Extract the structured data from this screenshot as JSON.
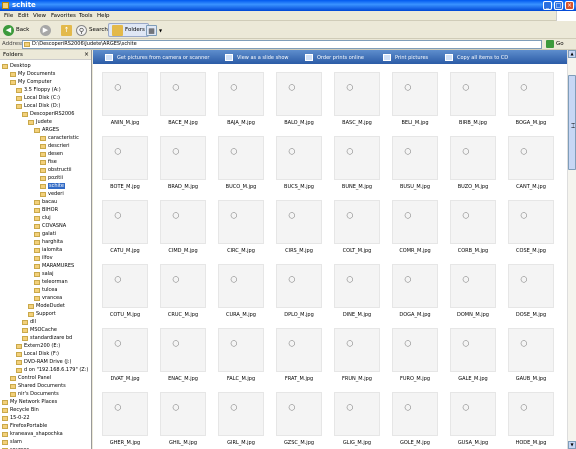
{
  "window": {
    "title": "schite",
    "minimize": "_",
    "maximize": "□",
    "close": "×"
  },
  "menu": [
    "File",
    "Edit",
    "View",
    "Favorites",
    "Tools",
    "Help"
  ],
  "toolbar": {
    "back": "Back",
    "search": "Search",
    "folders": "Folders"
  },
  "address": {
    "label": "Address",
    "path": "D:\\DescoperiRS2006\\Judete\\ARGES\\schite",
    "go": "Go"
  },
  "folders_pane": {
    "title": "Folders",
    "tree": [
      {
        "label": "Desktop",
        "sel": false
      },
      {
        "label": "My Documents",
        "sel": false
      },
      {
        "label": "My Computer",
        "sel": false
      },
      {
        "label": "3.5 Floppy (A:)",
        "sel": false
      },
      {
        "label": "Local Disk (C:)",
        "sel": false
      },
      {
        "label": "Local Disk (D:)",
        "sel": false
      },
      {
        "label": "DescoperiRS2006",
        "sel": false
      },
      {
        "label": "Judete",
        "sel": false
      },
      {
        "label": "ARGES",
        "sel": false
      },
      {
        "label": "caracteristic",
        "sel": false
      },
      {
        "label": "descrieri",
        "sel": false
      },
      {
        "label": "desen",
        "sel": false
      },
      {
        "label": "fise",
        "sel": false
      },
      {
        "label": "obstructii",
        "sel": false
      },
      {
        "label": "pozitii",
        "sel": false
      },
      {
        "label": "schite",
        "sel": true
      },
      {
        "label": "vederi",
        "sel": false
      },
      {
        "label": "bacau",
        "sel": false
      },
      {
        "label": "BIHOR",
        "sel": false
      },
      {
        "label": "cluj",
        "sel": false
      },
      {
        "label": "COVASNA",
        "sel": false
      },
      {
        "label": "galati",
        "sel": false
      },
      {
        "label": "harghita",
        "sel": false
      },
      {
        "label": "ialomita",
        "sel": false
      },
      {
        "label": "ilfov",
        "sel": false
      },
      {
        "label": "MARAMURES",
        "sel": false
      },
      {
        "label": "salaj",
        "sel": false
      },
      {
        "label": "teleorman",
        "sel": false
      },
      {
        "label": "tulcea",
        "sel": false
      },
      {
        "label": "vrancea",
        "sel": false
      },
      {
        "label": "ModeDudet",
        "sel": false
      },
      {
        "label": "Support",
        "sel": false
      },
      {
        "label": "dll",
        "sel": false
      },
      {
        "label": "MSOCache",
        "sel": false
      },
      {
        "label": "standardizare bd",
        "sel": false
      },
      {
        "label": "Extern200 (E:)",
        "sel": false
      },
      {
        "label": "Local Disk (F:)",
        "sel": false
      },
      {
        "label": "DVD-RAM Drive (J:)",
        "sel": false
      },
      {
        "label": "d on \"192.168.6.179\" (Z:)",
        "sel": false
      },
      {
        "label": "Control Panel",
        "sel": false
      },
      {
        "label": "Shared Documents",
        "sel": false
      },
      {
        "label": "nir's Documents",
        "sel": false
      },
      {
        "label": "My Network Places",
        "sel": false
      },
      {
        "label": "Recycle Bin",
        "sel": false
      },
      {
        "label": "15-0-22",
        "sel": false
      },
      {
        "label": "FirefoxPortable",
        "sel": false
      },
      {
        "label": "kraneava_shapochka",
        "sel": false
      },
      {
        "label": "slam",
        "sel": false
      },
      {
        "label": "sources",
        "sel": false
      }
    ]
  },
  "tasks": [
    "Get pictures from camera or scanner",
    "View as a slide show",
    "Order prints online",
    "Print pictures",
    "Copy all items to CD"
  ],
  "thumbnails": [
    "ANIN_M.jpg",
    "BACE_M.jpg",
    "BAJA_M.jpg",
    "BALO_M.jpg",
    "BASC_M.jpg",
    "BELI_M.jpg",
    "BIRB_M.jpg",
    "BOGA_M.jpg",
    "BOTE_M.jpg",
    "BRAD_M.jpg",
    "BUCO_M.jpg",
    "BUCS_M.jpg",
    "BUNE_M.jpg",
    "BUSU_M.jpg",
    "BUZO_M.jpg",
    "CANT_M.jpg",
    "CATU_M.jpg",
    "CIMD_M.jpg",
    "CIRC_M.jpg",
    "CIRS_M.jpg",
    "COLT_M.jpg",
    "COMR_M.jpg",
    "CORB_M.jpg",
    "COSE_M.jpg",
    "COTU_M.jpg",
    "CRUC_M.jpg",
    "CURA_M.jpg",
    "DPLO_M.jpg",
    "DINE_M.jpg",
    "DOGA_M.jpg",
    "DOMN_M.jpg",
    "DOSE_M.jpg",
    "DVAT_M.jpg",
    "ENAC_M.jpg",
    "FALC_M.jpg",
    "FRAT_M.jpg",
    "FRUN_M.jpg",
    "FURO_M.jpg",
    "GALE_M.jpg",
    "GAUB_M.jpg",
    "GHER_M.jpg",
    "GHIL_M.jpg",
    "GIRL_M.jpg",
    "GZSC_M.jpg",
    "GLIG_M.jpg",
    "GOLE_M.jpg",
    "GUSA_M.jpg",
    "HODE_M.jpg"
  ]
}
